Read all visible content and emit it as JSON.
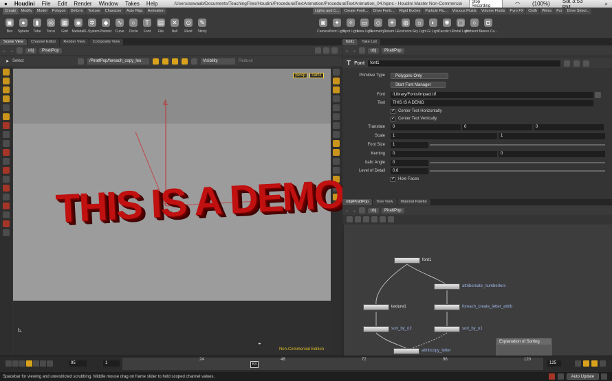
{
  "menubar": {
    "app": "Houdini",
    "items": [
      "File",
      "Edit",
      "Render",
      "Window",
      "Takes",
      "Help"
    ],
    "title": "/Users/aswaab/Documents/TeachingFiles/Houdini/ProceduralTextAnimation/ProceduralTextAnimation_04.hipnc - Houdini Master Non-Commercial",
    "recording": "Stop Recording",
    "battery": "(100%)",
    "clock": "Sat 3:53 PM"
  },
  "shelf": {
    "tabs_left": [
      "Create",
      "Modify",
      "Model",
      "Polygon",
      "Deform",
      "Texture",
      "Character",
      "Auto Rigs",
      "Animation"
    ],
    "tabs_right": [
      "Lights and C...",
      "Create Fonti...",
      "Drive Fonti...",
      "Rigid Bodies",
      "Particle Flu...",
      "Viscous Fluids",
      "Volume Fluids",
      "Pyro FX",
      "Cloth",
      "Wires",
      "Fur",
      "Drive Simul..."
    ],
    "tools_left": [
      {
        "label": "Box",
        "icon": "box-icon",
        "glyph": "▣"
      },
      {
        "label": "Sphere",
        "icon": "sphere-icon",
        "glyph": "●"
      },
      {
        "label": "Tube",
        "icon": "tube-icon",
        "glyph": "▮"
      },
      {
        "label": "Torus",
        "icon": "torus-icon",
        "glyph": "◎"
      },
      {
        "label": "Grid",
        "icon": "grid-icon",
        "glyph": "▦"
      },
      {
        "label": "Metaball",
        "icon": "metaball-icon",
        "glyph": "◉"
      },
      {
        "label": "L-System",
        "icon": "lsystem-icon",
        "glyph": "✲"
      },
      {
        "label": "Platonic",
        "icon": "platonic-icon",
        "glyph": "◆"
      },
      {
        "label": "Curve",
        "icon": "curve-icon",
        "glyph": "∿"
      },
      {
        "label": "Circle",
        "icon": "circle-icon",
        "glyph": "○"
      },
      {
        "label": "Font",
        "icon": "font-icon",
        "glyph": "T"
      },
      {
        "label": "File",
        "icon": "file-icon",
        "glyph": "▤"
      },
      {
        "label": "Null",
        "icon": "null-icon",
        "glyph": "✕"
      },
      {
        "label": "Rivet",
        "icon": "rivet-icon",
        "glyph": "⊙"
      },
      {
        "label": "Sticky",
        "icon": "sticky-icon",
        "glyph": "✎"
      }
    ],
    "tools_right": [
      {
        "label": "Camera",
        "icon": "camera-icon",
        "glyph": "◙"
      },
      {
        "label": "Point Light",
        "icon": "point-light-icon",
        "glyph": "✦"
      },
      {
        "label": "Spot Light",
        "icon": "spot-light-icon",
        "glyph": "✧"
      },
      {
        "label": "Area Light",
        "icon": "area-light-icon",
        "glyph": "▭"
      },
      {
        "label": "Geometry...",
        "icon": "geometry-light-icon",
        "glyph": "◇"
      },
      {
        "label": "Distant Li...",
        "icon": "distant-light-icon",
        "glyph": "☀"
      },
      {
        "label": "Environm...",
        "icon": "environment-light-icon",
        "glyph": "◍"
      },
      {
        "label": "Sky Light",
        "icon": "sky-light-icon",
        "glyph": "☼"
      },
      {
        "label": "GI Light",
        "icon": "gi-light-icon",
        "glyph": "◐"
      },
      {
        "label": "Caustic Li...",
        "icon": "caustic-light-icon",
        "glyph": "✺"
      },
      {
        "label": "Portal Light",
        "icon": "portal-light-icon",
        "glyph": "▢"
      },
      {
        "label": "Ambient L...",
        "icon": "ambient-light-icon",
        "glyph": "○"
      },
      {
        "label": "Stereo Ca...",
        "icon": "stereo-camera-icon",
        "glyph": "◘"
      }
    ]
  },
  "scene": {
    "tabs": [
      "Scene View",
      "Channel Editor",
      "Render View",
      "Composite View"
    ],
    "path_root": "obj",
    "path_node": "PirattPop",
    "tool": "Select",
    "op_field": "/PirattPop/foreach_copy_leu",
    "visibility": "Visibility",
    "reduce": "Reduce",
    "persp": "persp",
    "cam": "cam1",
    "watermark": "Non-Commercial Edition",
    "demo_text": "THIS IS A DEMO"
  },
  "params": {
    "tabs": [
      "font1",
      "Take List"
    ],
    "path_root": "obj",
    "path_node": "PirattPop",
    "node_type": "Font",
    "node_name": "font1",
    "primitive_type_label": "Primitive Type",
    "primitive_type": "Polygons Only",
    "font_manager": "Start Font Manager",
    "font_label": "Font",
    "font": "/Library/Fonts/Impact.ttf",
    "text_label": "Text",
    "text": "THIS IS A DEMO",
    "center_h": "Center Text Horizontally",
    "center_v": "Center Text Vertically",
    "translate_label": "Translate",
    "translate": [
      "0",
      "0",
      "0"
    ],
    "scale_label": "Scale",
    "scale": [
      "1",
      "1"
    ],
    "fontsize_label": "Font Size",
    "fontsize": "1",
    "kerning_label": "Kerning",
    "kerning": [
      "0",
      "0"
    ],
    "italic_label": "Italic Angle",
    "italic": "0",
    "lod_label": "Level of Detail",
    "lod": "0.6",
    "hole_faces": "Hole Faces"
  },
  "network": {
    "tabs": [
      "/obj/PirattPop",
      "Tree View",
      "Material Palette"
    ],
    "path_root": "obj",
    "path_node": "PirattPop",
    "nodes": {
      "font1": "font1",
      "attribcreate": "attribcreate_numberlers",
      "texture1": "texture1",
      "foreach": "foreach_create_letter_attrib",
      "sort_by_n2": "sort_by_n2",
      "sort_by_n1": "sort_by_n1",
      "attribcopy": "attribcopy_letter"
    },
    "sticky_title": "Explanation of Sorting"
  },
  "timeline": {
    "current_frame": "95",
    "start_frame": "1",
    "end_frame": "125",
    "ticks": [
      "24",
      "48",
      "72",
      "96",
      "120"
    ],
    "cursor_label": "63"
  },
  "status": {
    "text": "Spacebar for viewing and unrestricted scrubbing. Middle mouse drag on frame slider to hold scoped channel values.",
    "auto_update": "Auto Update"
  }
}
